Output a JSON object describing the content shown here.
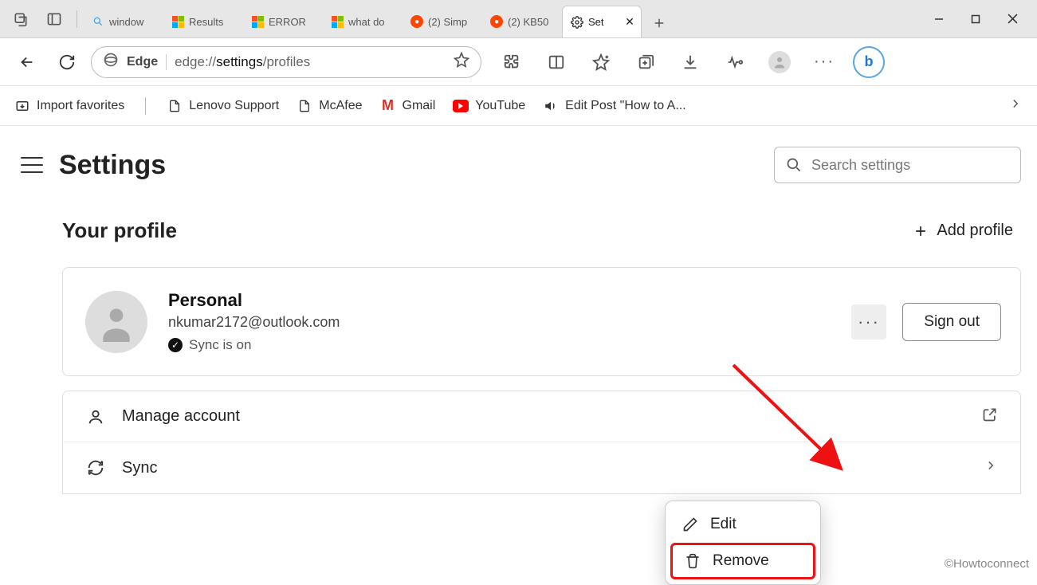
{
  "titlebar": {
    "tabs": [
      {
        "label": "window",
        "icon": "search"
      },
      {
        "label": "Results",
        "icon": "ms"
      },
      {
        "label": "ERROR",
        "icon": "ms"
      },
      {
        "label": "what do",
        "icon": "ms"
      },
      {
        "label": "(2) Simp",
        "icon": "reddit"
      },
      {
        "label": "(2) KB50",
        "icon": "reddit"
      },
      {
        "label": "Set",
        "icon": "gear",
        "active": true
      }
    ]
  },
  "addressbar": {
    "prefix": "Edge",
    "host": "edge://",
    "path_bold": "settings",
    "path_rest": "/profiles"
  },
  "bookmarks": {
    "import": "Import favorites",
    "items": [
      {
        "label": "Lenovo Support",
        "icon": "doc"
      },
      {
        "label": "McAfee",
        "icon": "doc"
      },
      {
        "label": "Gmail",
        "icon": "gmail"
      },
      {
        "label": "YouTube",
        "icon": "youtube"
      },
      {
        "label": "Edit Post \"How to A...",
        "icon": "speaker"
      }
    ]
  },
  "settings": {
    "title": "Settings",
    "search_placeholder": "Search settings",
    "section_title": "Your profile",
    "add_profile": "Add profile",
    "profile": {
      "name": "Personal",
      "email": "nkumar2172@outlook.com",
      "sync_status": "Sync is on",
      "signout": "Sign out"
    },
    "list": [
      {
        "label": "Manage account",
        "icon": "person",
        "arrow": "external"
      },
      {
        "label": "Sync",
        "icon": "sync",
        "arrow": "chevron"
      }
    ]
  },
  "ctx": {
    "edit": "Edit",
    "remove": "Remove"
  },
  "watermark": "©Howtoconnect"
}
